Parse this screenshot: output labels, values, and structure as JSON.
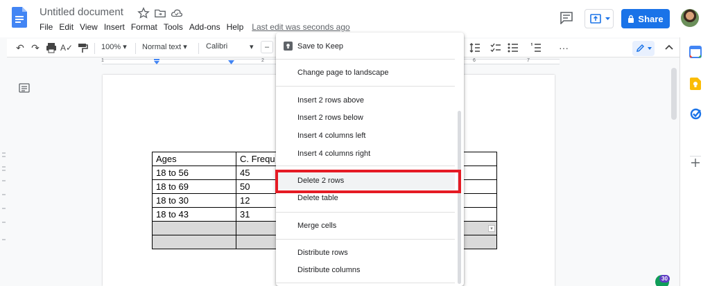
{
  "doc": {
    "title": "Untitled document",
    "last_edit": "Last edit was seconds ago"
  },
  "menubar": [
    "File",
    "Edit",
    "View",
    "Insert",
    "Format",
    "Tools",
    "Add-ons",
    "Help"
  ],
  "share": {
    "label": "Share"
  },
  "toolbar": {
    "zoom": "100%",
    "style": "Normal text",
    "font": "Calibri"
  },
  "ruler": [
    "1",
    "2",
    "6",
    "7"
  ],
  "table": {
    "rows": [
      [
        "Ages",
        "C. Frequ"
      ],
      [
        "18 to 56",
        "45"
      ],
      [
        "18 to 69",
        "50"
      ],
      [
        "18 to 30",
        "12"
      ],
      [
        "18 to 43",
        "31"
      ],
      [
        "",
        ""
      ],
      [
        "",
        ""
      ]
    ]
  },
  "context_menu": {
    "items": [
      "Save to Keep",
      "Change page to landscape",
      "Insert 2 rows above",
      "Insert 2 rows below",
      "Insert 4 columns left",
      "Insert 4 columns right",
      "Delete 2 rows",
      "Delete table",
      "Merge cells",
      "Distribute rows",
      "Distribute columns"
    ],
    "highlighted": "Delete 2 rows"
  },
  "badge": {
    "count": "30"
  },
  "colors": {
    "accent": "#1a73e8",
    "highlight": "#e51b24"
  }
}
